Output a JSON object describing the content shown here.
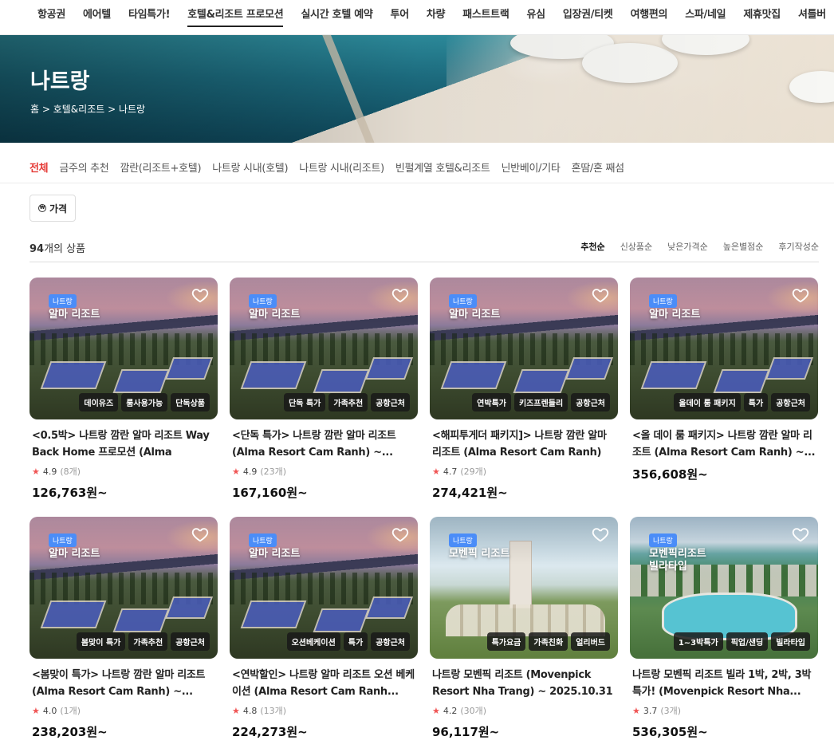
{
  "topnav": [
    "항공권",
    "에어텔",
    "타임특가!",
    "호텔&리조트 프로모션",
    "실시간 호텔 예약",
    "투어",
    "차량",
    "패스트트랙",
    "유심",
    "입장권/티켓",
    "여행편의",
    "스파/네일",
    "제휴맛집",
    "셔틀버"
  ],
  "hero": {
    "title": "나트랑",
    "breadcrumb": "홈 > 호텔&리조트 > 나트랑"
  },
  "categories": [
    "전체",
    "금주의 추천",
    "깜란(리조트+호텔)",
    "나트랑 시내(호텔)",
    "나트랑 시내(리조트)",
    "빈펄계열 호텔&리조트",
    "닌반베이/기타",
    "혼땀/혼 째섬"
  ],
  "filter": {
    "label": "가격"
  },
  "count": {
    "number": "94",
    "suffix": "개의 상품"
  },
  "sorts": [
    "추천순",
    "신상품순",
    "낮은가격순",
    "높은별점순",
    "후기작성순"
  ],
  "products": [
    {
      "region": "나트랑",
      "name": "알마 리조트",
      "tags": [
        "데이유즈",
        "룸사용가능",
        "단독상품"
      ],
      "title": "<0.5박> 나트랑 깜란 알마 리조트 Way Back Home 프로모션 (Alma Resor...",
      "rating": "4.9",
      "reviews": "(8개)",
      "price": "126,763원~",
      "image": "alma"
    },
    {
      "region": "나트랑",
      "name": "알마 리조트",
      "tags": [
        "단독 특가",
        "가족추천",
        "공항근처"
      ],
      "title": "<단독 특가> 나트랑 깜란 알마 리조트 (Alma Resort Cam Ranh) ~...",
      "rating": "4.9",
      "reviews": "(23개)",
      "price": "167,160원~",
      "image": "alma"
    },
    {
      "region": "나트랑",
      "name": "알마 리조트",
      "tags": [
        "연박특가",
        "키즈프렌들리",
        "공항근처"
      ],
      "title": "<해피투게더 패키지]> 나트랑 깜란 알마 리조트 (Alma Resort Cam Ranh) ~...",
      "rating": "4.7",
      "reviews": "(29개)",
      "price": "274,421원~",
      "image": "alma"
    },
    {
      "region": "나트랑",
      "name": "알마 리조트",
      "tags": [
        "올데이 룸 패키지",
        "특가",
        "공항근처"
      ],
      "title": "<올 데이 룸 패키지> 나트랑 깜란 알마 리조트 (Alma Resort Cam Ranh) ~...",
      "rating": "",
      "reviews": "",
      "price": "356,608원~",
      "image": "alma"
    },
    {
      "region": "나트랑",
      "name": "알마 리조트",
      "tags": [
        "봄맞이 특가",
        "가족추천",
        "공항근처"
      ],
      "title": "<봄맞이 특가> 나트랑 깜란 알마 리조트 (Alma Resort Cam Ranh) ~...",
      "rating": "4.0",
      "reviews": "(1개)",
      "price": "238,203원~",
      "image": "alma"
    },
    {
      "region": "나트랑",
      "name": "알마 리조트",
      "tags": [
        "오션베케이션",
        "특가",
        "공항근처"
      ],
      "title": "<연박할인> 나트랑 알마 리조트 오션 베케이션 (Alma Resort Cam Ranh...",
      "rating": "4.8",
      "reviews": "(13개)",
      "price": "224,273원~",
      "image": "alma"
    },
    {
      "region": "나트랑",
      "name": "모벤픽 리조트",
      "tags": [
        "특가요금",
        "가족친화",
        "얼리버드"
      ],
      "title": "나트랑 모벤픽 리조트 (Movenpick Resort Nha Trang) ~ 2025.10.31",
      "rating": "4.2",
      "reviews": "(30개)",
      "price": "96,117원~",
      "image": "movenpick"
    },
    {
      "region": "나트랑",
      "name": "모벤픽리조트\n빌라타입",
      "tags": [
        "1~3박특가",
        "픽업/샌딩",
        "빌라타입"
      ],
      "title": "나트랑 모벤픽 리조트 빌라 1박, 2박, 3박 특가! (Movenpick Resort Nha...",
      "rating": "3.7",
      "reviews": "(3개)",
      "price": "536,305원~",
      "image": "villa"
    }
  ]
}
